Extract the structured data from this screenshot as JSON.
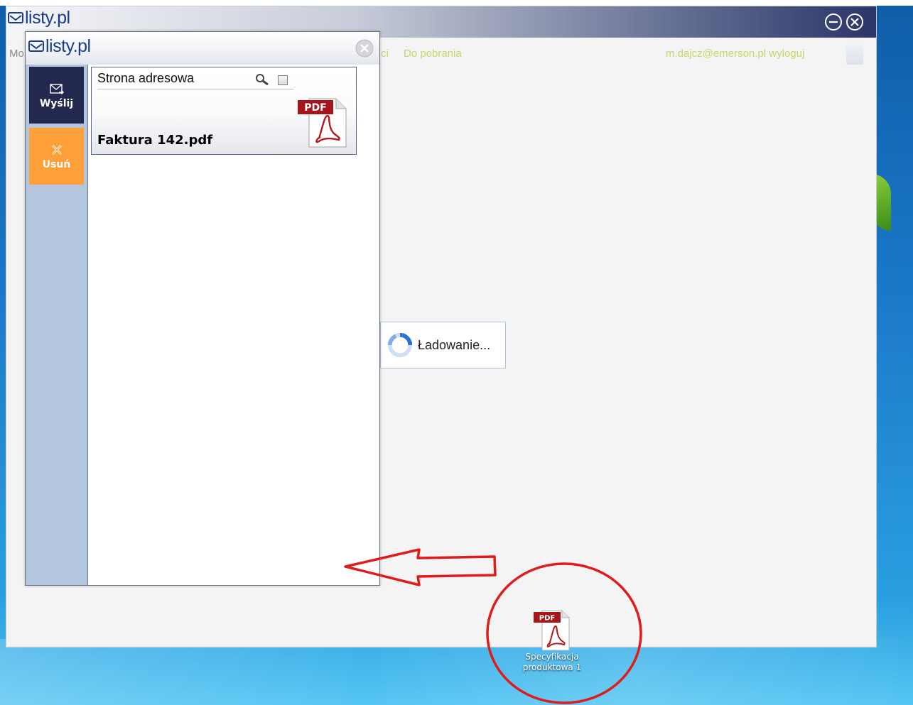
{
  "main_window": {
    "logo_text": "listy.pl",
    "nav": {
      "partial_left": "Mo",
      "partial_d": "ci",
      "downloads": "Do pobrania"
    },
    "user_email": "m.dajcz@emerson.pl",
    "logout_label": "wyloguj",
    "loading_text": "Ładowanie..."
  },
  "popup": {
    "logo_text": "listy.pl",
    "sidebar": {
      "send_label": "Wyślij",
      "delete_label": "Usuń"
    },
    "document": {
      "section_title": "Strona adresowa",
      "filename": "Faktura 142.pdf",
      "badge": "PDF"
    }
  },
  "desktop_icon": {
    "badge": "PDF",
    "label_line1": "Specyfikacja",
    "label_line2": "produktowa 1"
  },
  "colors": {
    "send_button": "#23284f",
    "delete_button": "#ff9f3a",
    "sidebar": "#b4c6dd",
    "nav_text": "#c9d46a",
    "annotation": "#e01b1b",
    "pdf_red": "#b31b1b"
  }
}
